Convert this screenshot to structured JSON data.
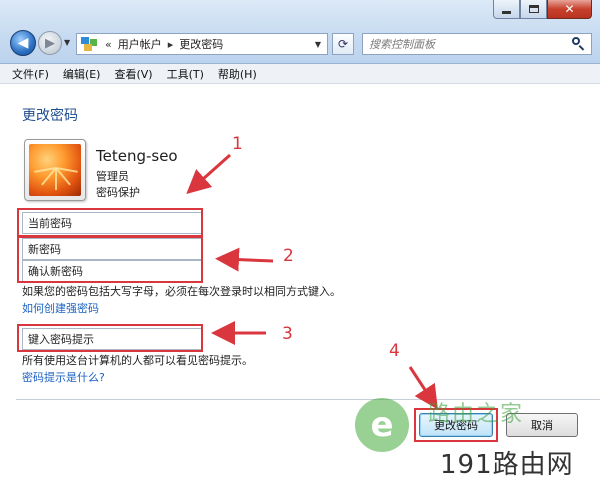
{
  "window": {
    "controls": {
      "minimize_icon": "minimize-icon",
      "maximize_icon": "maximize-icon",
      "close_icon": "close-icon",
      "close_glyph": "✕"
    }
  },
  "navbar": {
    "back_icon": "back-arrow-icon",
    "forward_icon": "forward-arrow-icon",
    "breadcrumb": {
      "overflow": "«",
      "items": [
        "用户帐户",
        "更改密码"
      ],
      "separator": "▸"
    },
    "search": {
      "placeholder": "搜索控制面板"
    }
  },
  "menubar": {
    "items": [
      {
        "label": "文件(F)"
      },
      {
        "label": "编辑(E)"
      },
      {
        "label": "查看(V)"
      },
      {
        "label": "工具(T)"
      },
      {
        "label": "帮助(H)"
      }
    ]
  },
  "page": {
    "title": "更改密码",
    "user": {
      "name": "Teteng-seo",
      "role": "管理员",
      "protection": "密码保护"
    },
    "fields": {
      "current_password": {
        "value": "当前密码"
      },
      "new_password": {
        "value": "新密码"
      },
      "confirm_password": {
        "value": "确认新密码"
      },
      "hint": {
        "value": "键入密码提示"
      }
    },
    "texts": {
      "case_note": "如果您的密码包括大写字母，必须在每次登录时以相同方式键入。",
      "strong_link": "如何创建强密码",
      "hint_note": "所有使用这台计算机的人都可以看见密码提示。",
      "hint_link": "密码提示是什么?"
    },
    "buttons": {
      "change": "更改密码",
      "cancel": "取消"
    },
    "annotations": {
      "step1": "1",
      "step2": "2",
      "step3": "3",
      "step4": "4"
    },
    "annotation_color": "#d9363e"
  },
  "watermark": {
    "logo_glyph": "e",
    "site_cn": "路由之家",
    "domain": "191路由网"
  }
}
